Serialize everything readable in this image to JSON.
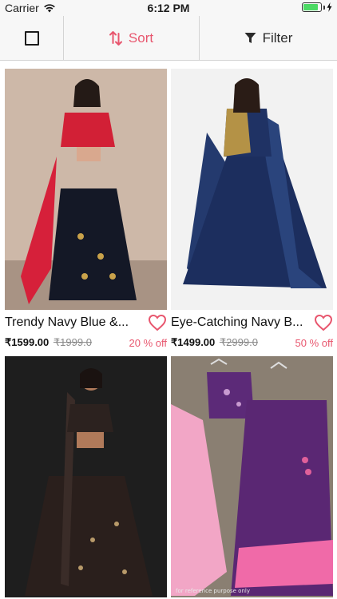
{
  "status_bar": {
    "carrier": "Carrier",
    "time": "6:12 PM",
    "battery_level": 0.85,
    "battery_color": "#4cd964"
  },
  "toolbar": {
    "sort_label": "Sort",
    "filter_label": "Filter",
    "accent_color": "#e8566e"
  },
  "products": [
    {
      "name": "Trendy Navy Blue &...",
      "price": "₹1599.00",
      "mrp": "₹1999.0",
      "discount": "20 % off"
    },
    {
      "name": "Eye-Catching Navy B...",
      "price": "₹1499.00",
      "mrp": "₹2999.0",
      "discount": "50 % off"
    },
    {
      "image_overlay": "for reference purpose only"
    }
  ]
}
